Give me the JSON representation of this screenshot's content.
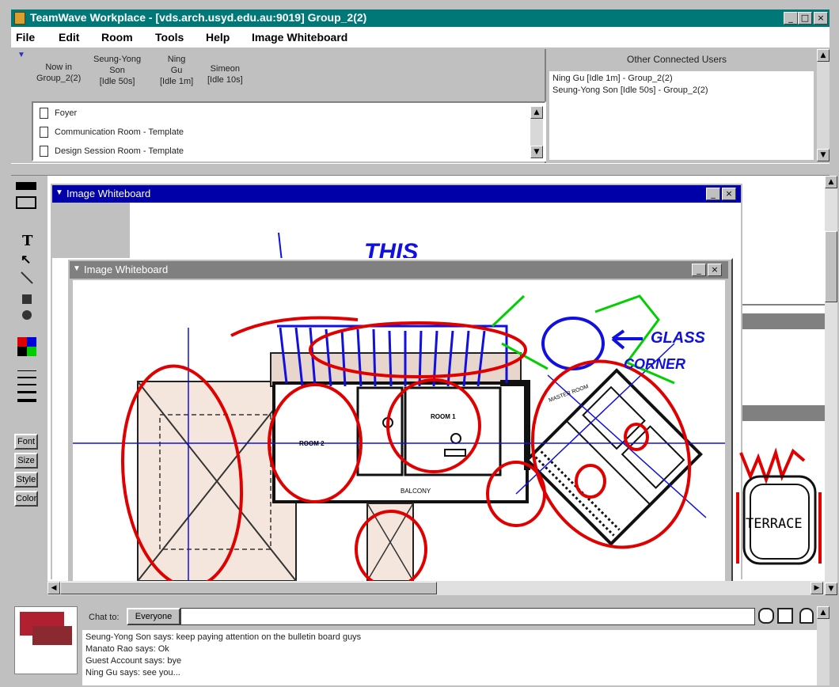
{
  "window": {
    "title": "TeamWave Workplace - [vds.arch.usyd.edu.au:9019] Group_2(2)",
    "min": "_",
    "max": "□",
    "close": "×"
  },
  "menu": [
    "File",
    "Edit",
    "Room",
    "Tools",
    "Help",
    "Image Whiteboard"
  ],
  "presence": {
    "now_in": "Now in\nGroup_2(2)",
    "users": [
      {
        "name": "Seung-Yong\nSon",
        "status": "[Idle 50s]"
      },
      {
        "name": "Ning\nGu",
        "status": "[Idle 1m]"
      },
      {
        "name": "Simeon",
        "status": "[Idle 10s]"
      }
    ]
  },
  "rooms": [
    "Foyer",
    "Communication Room - Template",
    "Design Session Room - Template"
  ],
  "other_users": {
    "header": "Other Connected Users",
    "items": [
      "Ning Gu [Idle 1m] - Group_2(2)",
      "Seung-Yong Son [Idle 50s] - Group_2(2)"
    ]
  },
  "tools": {
    "text": "T",
    "pointer": "↖",
    "buttons": [
      "Font",
      "Size",
      "Style",
      "Color"
    ]
  },
  "whiteboard_back": {
    "title": "Image Whiteboard",
    "sketch_text": "THIS"
  },
  "whiteboard_front": {
    "title": "Image Whiteboard",
    "annotations": [
      "GLASS",
      "CORNER",
      "TERRACE"
    ],
    "plan_labels": [
      "MASTER ROOM",
      "ROOM 2",
      "ROOM 1",
      "BALCONY"
    ]
  },
  "chat": {
    "to_label": "Chat to:",
    "recipient": "Everyone",
    "input_value": "",
    "messages": [
      "Seung-Yong Son says: keep paying attention on the bulletin board guys",
      "Manato Rao says: Ok",
      "Guest Account says: bye",
      "Ning Gu says: see you..."
    ]
  },
  "colors": {
    "titlebar": "#007878",
    "active_title": "#0000a8",
    "inactive_title": "#808080",
    "ink_red": "#e00000",
    "ink_blue": "#1010e0",
    "ink_green": "#00d000"
  }
}
